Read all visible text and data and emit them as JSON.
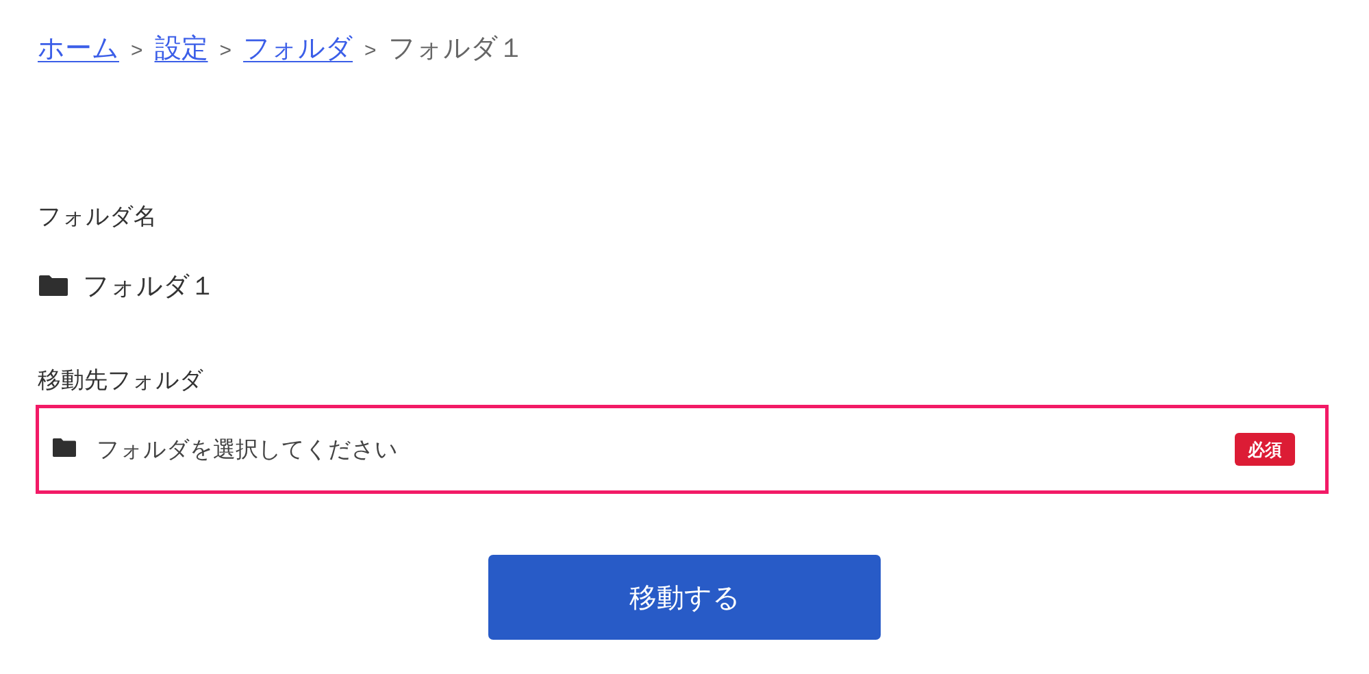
{
  "breadcrumb": {
    "items": [
      {
        "kind": "link",
        "label": "ホーム"
      },
      {
        "kind": "separator",
        "label": ">"
      },
      {
        "kind": "link",
        "label": "設定"
      },
      {
        "kind": "separator",
        "label": ">"
      },
      {
        "kind": "link",
        "label": "フォルダ"
      },
      {
        "kind": "separator",
        "label": ">"
      },
      {
        "kind": "current",
        "label": "フォルダ１"
      }
    ]
  },
  "folder_name": {
    "label": "フォルダ名",
    "value": "フォルダ１"
  },
  "destination": {
    "label": "移動先フォルダ",
    "placeholder": "フォルダを選択してください",
    "badge": "必須"
  },
  "submit_button": {
    "label": "移動する"
  }
}
